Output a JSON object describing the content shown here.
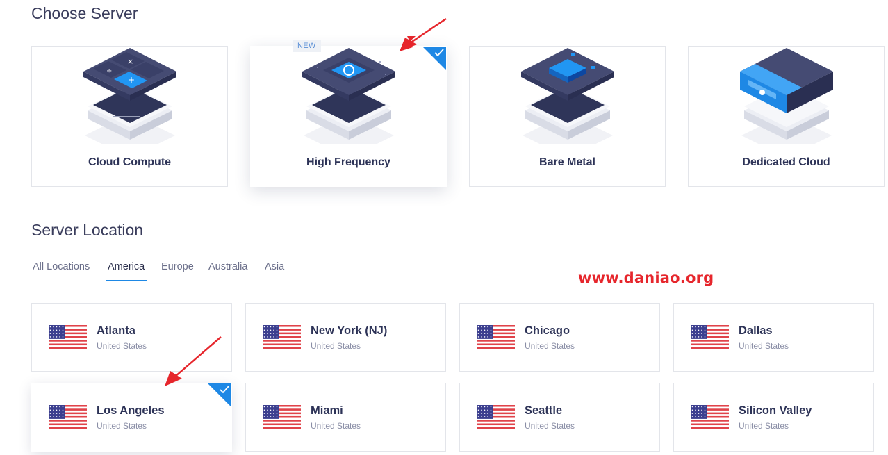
{
  "choose_server": {
    "title": "Choose Server",
    "cards": [
      {
        "label": "Cloud Compute",
        "selected": false
      },
      {
        "label": "High Frequency",
        "selected": true,
        "badge": "NEW"
      },
      {
        "label": "Bare Metal",
        "selected": false
      },
      {
        "label": "Dedicated Cloud",
        "selected": false
      }
    ]
  },
  "server_location": {
    "title": "Server Location",
    "tabs": [
      {
        "label": "All Locations",
        "active": false
      },
      {
        "label": "America",
        "active": true
      },
      {
        "label": "Europe",
        "active": false
      },
      {
        "label": "Australia",
        "active": false
      },
      {
        "label": "Asia",
        "active": false
      }
    ],
    "locations": [
      {
        "city": "Atlanta",
        "country": "United States",
        "selected": false
      },
      {
        "city": "New York (NJ)",
        "country": "United States",
        "selected": false
      },
      {
        "city": "Chicago",
        "country": "United States",
        "selected": false
      },
      {
        "city": "Dallas",
        "country": "United States",
        "selected": false
      },
      {
        "city": "Los Angeles",
        "country": "United States",
        "selected": true
      },
      {
        "city": "Miami",
        "country": "United States",
        "selected": false
      },
      {
        "city": "Seattle",
        "country": "United States",
        "selected": false
      },
      {
        "city": "Silicon Valley",
        "country": "United States",
        "selected": false
      }
    ]
  },
  "watermark": "www.daniao.org",
  "colors": {
    "accent": "#1e88e5",
    "title": "#3a3d5c",
    "card_text": "#2d3357",
    "muted": "#8a8ea6",
    "arrow": "#e6262c",
    "watermark": "#e6262c"
  },
  "icons": [
    "cloud-compute-server-icon",
    "high-frequency-server-icon",
    "bare-metal-server-icon",
    "dedicated-cloud-server-icon",
    "us-flag-icon",
    "checkmark-icon",
    "red-arrow-annotation"
  ]
}
